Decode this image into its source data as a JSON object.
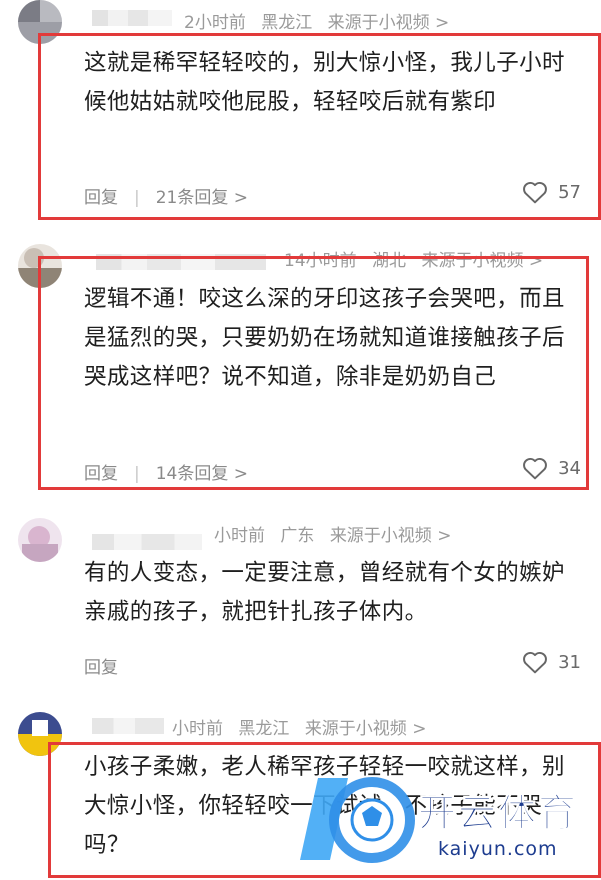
{
  "comments": [
    {
      "time": "2小时前",
      "location": "黑龙江",
      "source": "来源于小视频 >",
      "text": "这就是稀罕轻轻咬的，别大惊小怪，我儿子小时候他姑姑就咬他屁股，轻轻咬后就有紫印",
      "reply": "回复",
      "reply_count": "21条回复 >",
      "likes": "57"
    },
    {
      "time": "14小时前",
      "location": "湖北",
      "source": "来源于小视频 >",
      "text": "逻辑不通！咬这么深的牙印这孩子会哭吧，而且是猛烈的哭，只要奶奶在场就知道谁接触孩子后哭成这样吧？说不知道，除非是奶奶自己",
      "reply": "回复",
      "reply_count": "14条回复 >",
      "likes": "34"
    },
    {
      "time": "小时前",
      "location": "广东",
      "source": "来源于小视频 >",
      "text": "有的人变态，一定要注意，曾经就有个女的嫉妒亲戚的孩子，就把针扎孩子体内。",
      "reply": "回复",
      "likes": "31"
    },
    {
      "time": "小时前",
      "location": "黑龙江",
      "source": "来源于小视频 >",
      "text": "小孩子柔嫩，老人稀罕孩子轻轻一咬就这样，别大惊小怪，你轻轻咬一下试试，不孩子能不哭吗？"
    }
  ],
  "watermark": {
    "brand": "开云体育",
    "domain": "kaiyun.com"
  },
  "colors": {
    "highlight": "#e23a3a",
    "meta": "#9a9a9a",
    "text": "#1f1f1f"
  }
}
